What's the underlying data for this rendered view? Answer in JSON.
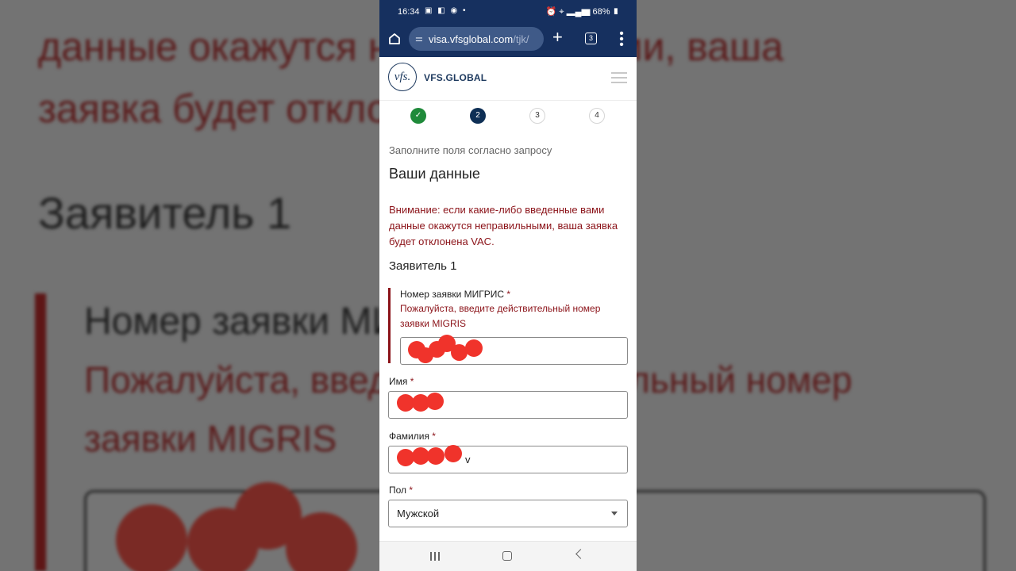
{
  "status": {
    "time": "16:34",
    "battery": "68%"
  },
  "browser": {
    "url_main": "visa.vfsglobal.com",
    "url_rest": "/tjk/",
    "tab_count": "3",
    "plus": "+",
    "more": "⋮"
  },
  "site": {
    "logo_text": "vfs.",
    "brand": "VFS.GLOBAL"
  },
  "steps": {
    "active": "2",
    "step3": "3",
    "step4": "4",
    "done_mark": "✓"
  },
  "form": {
    "subtitle": "Заполните поля согласно запросу",
    "title": "Ваши данные",
    "warning": "Внимание: если какие-либо введенные вами данные окажутся неправильными, ваша заявка будет отклонена VAC.",
    "applicant": "Заявитель 1",
    "migris_label": "Номер заявки МИГРИС",
    "migris_error": "Пожалуйста, введите действительный номер заявки MIGRIS",
    "name_label": "Имя",
    "surname_label": "Фамилия",
    "surname_value_visible": "v",
    "gender_label": "Пол",
    "gender_value": "Мужской",
    "required_mark": "*"
  },
  "background": {
    "line1": "данные окажутся неправильными, ваша",
    "line2": "заявка будет отклонена VAC.",
    "heading": "Заявитель 1",
    "field_label": "Номер заявки МИГРИС",
    "error1": "Пожалуйста, введите действительный номер",
    "error2": "заявки MIGRIS"
  },
  "colors": {
    "statusbar": "#16305f",
    "error": "#8b1218",
    "active_step": "#0e2f55",
    "done_step": "#1f8a3a",
    "redaction": "#f0332b"
  }
}
